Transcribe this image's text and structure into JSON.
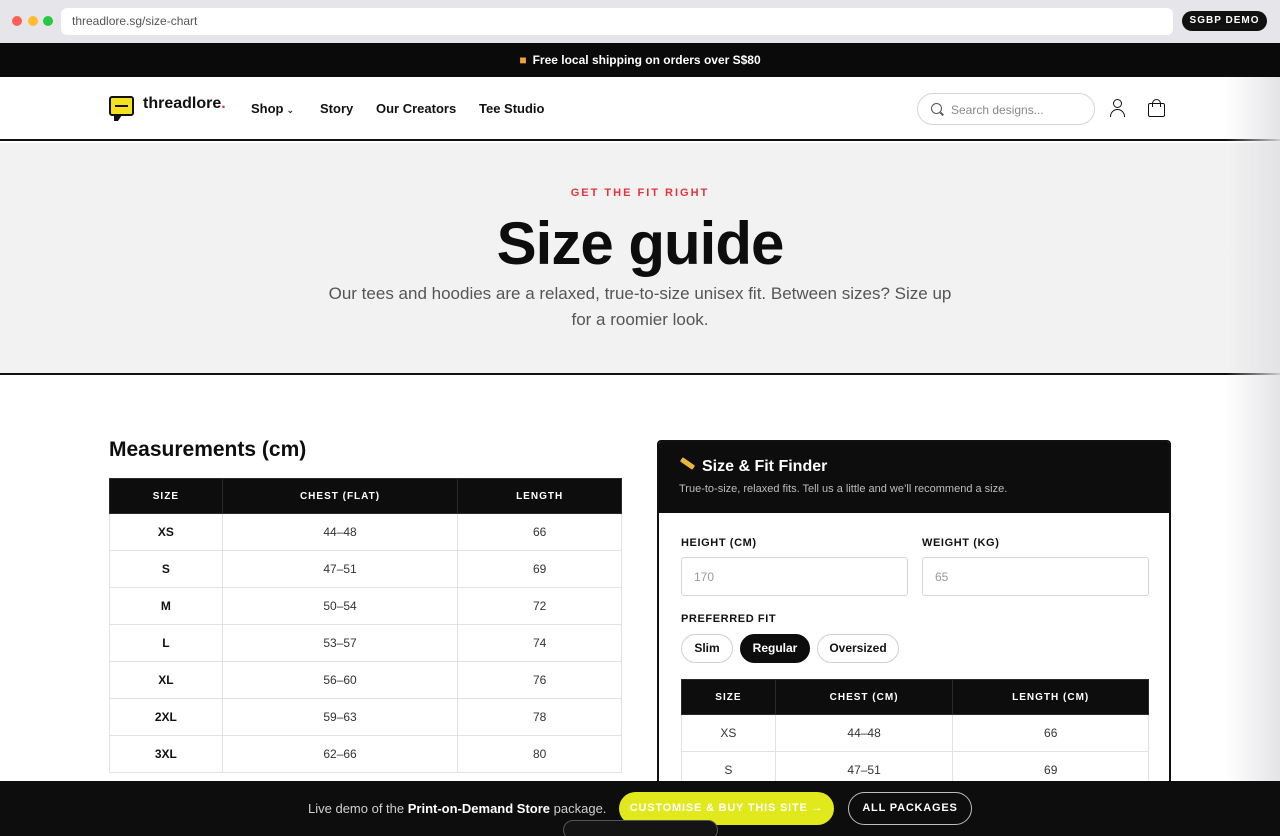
{
  "browser": {
    "url": "threadlore.sg/size-chart",
    "demo_badge": "SGBP DEMO"
  },
  "announcement": {
    "text": "Free local shipping on orders over S$80",
    "icon": "truck-icon"
  },
  "header": {
    "logo_text": "threadlore",
    "logo_dot": ".",
    "nav": [
      "Shop",
      "Story",
      "Our Creators",
      "Tee Studio"
    ],
    "search_placeholder": "Search designs..."
  },
  "hero": {
    "eyebrow": "GET THE FIT RIGHT",
    "title": "Size guide",
    "subtitle": "Our tees and hoodies are a relaxed, true-to-size unisex fit. Between sizes? Size up for a roomier look."
  },
  "measurements": {
    "title": "Measurements (cm)",
    "columns": [
      "SIZE",
      "CHEST (FLAT)",
      "LENGTH"
    ],
    "rows": [
      [
        "XS",
        "44–48",
        "66"
      ],
      [
        "S",
        "47–51",
        "69"
      ],
      [
        "M",
        "50–54",
        "72"
      ],
      [
        "L",
        "53–57",
        "74"
      ],
      [
        "XL",
        "56–60",
        "76"
      ],
      [
        "2XL",
        "59–63",
        "78"
      ],
      [
        "3XL",
        "62–66",
        "80"
      ]
    ]
  },
  "finder": {
    "title": "Size & Fit Finder",
    "subtitle": "True-to-size, relaxed fits. Tell us a little and we’ll recommend a size.",
    "height_label": "HEIGHT (CM)",
    "height_placeholder": "170",
    "weight_label": "WEIGHT (KG)",
    "weight_placeholder": "65",
    "fit_label": "PREFERRED FIT",
    "fits": [
      "Slim",
      "Regular",
      "Oversized"
    ],
    "selected_fit": "Regular",
    "columns": [
      "SIZE",
      "CHEST (CM)",
      "LENGTH (CM)"
    ],
    "rows": [
      [
        "XS",
        "44–48",
        "66"
      ],
      [
        "S",
        "47–51",
        "69"
      ]
    ]
  },
  "bottom_bar": {
    "text_prefix": "Live demo of the ",
    "text_bold": "Print-on-Demand Store",
    "text_suffix": " package.",
    "cta": "CUSTOMISE & BUY THIS SITE →",
    "all_packages": "ALL PACKAGES",
    "accent": "#e1e81c"
  },
  "colors": {
    "brand_red": "#e5333b",
    "dark": "#0d0d0d",
    "hero_bg": "#f2f2f3"
  }
}
